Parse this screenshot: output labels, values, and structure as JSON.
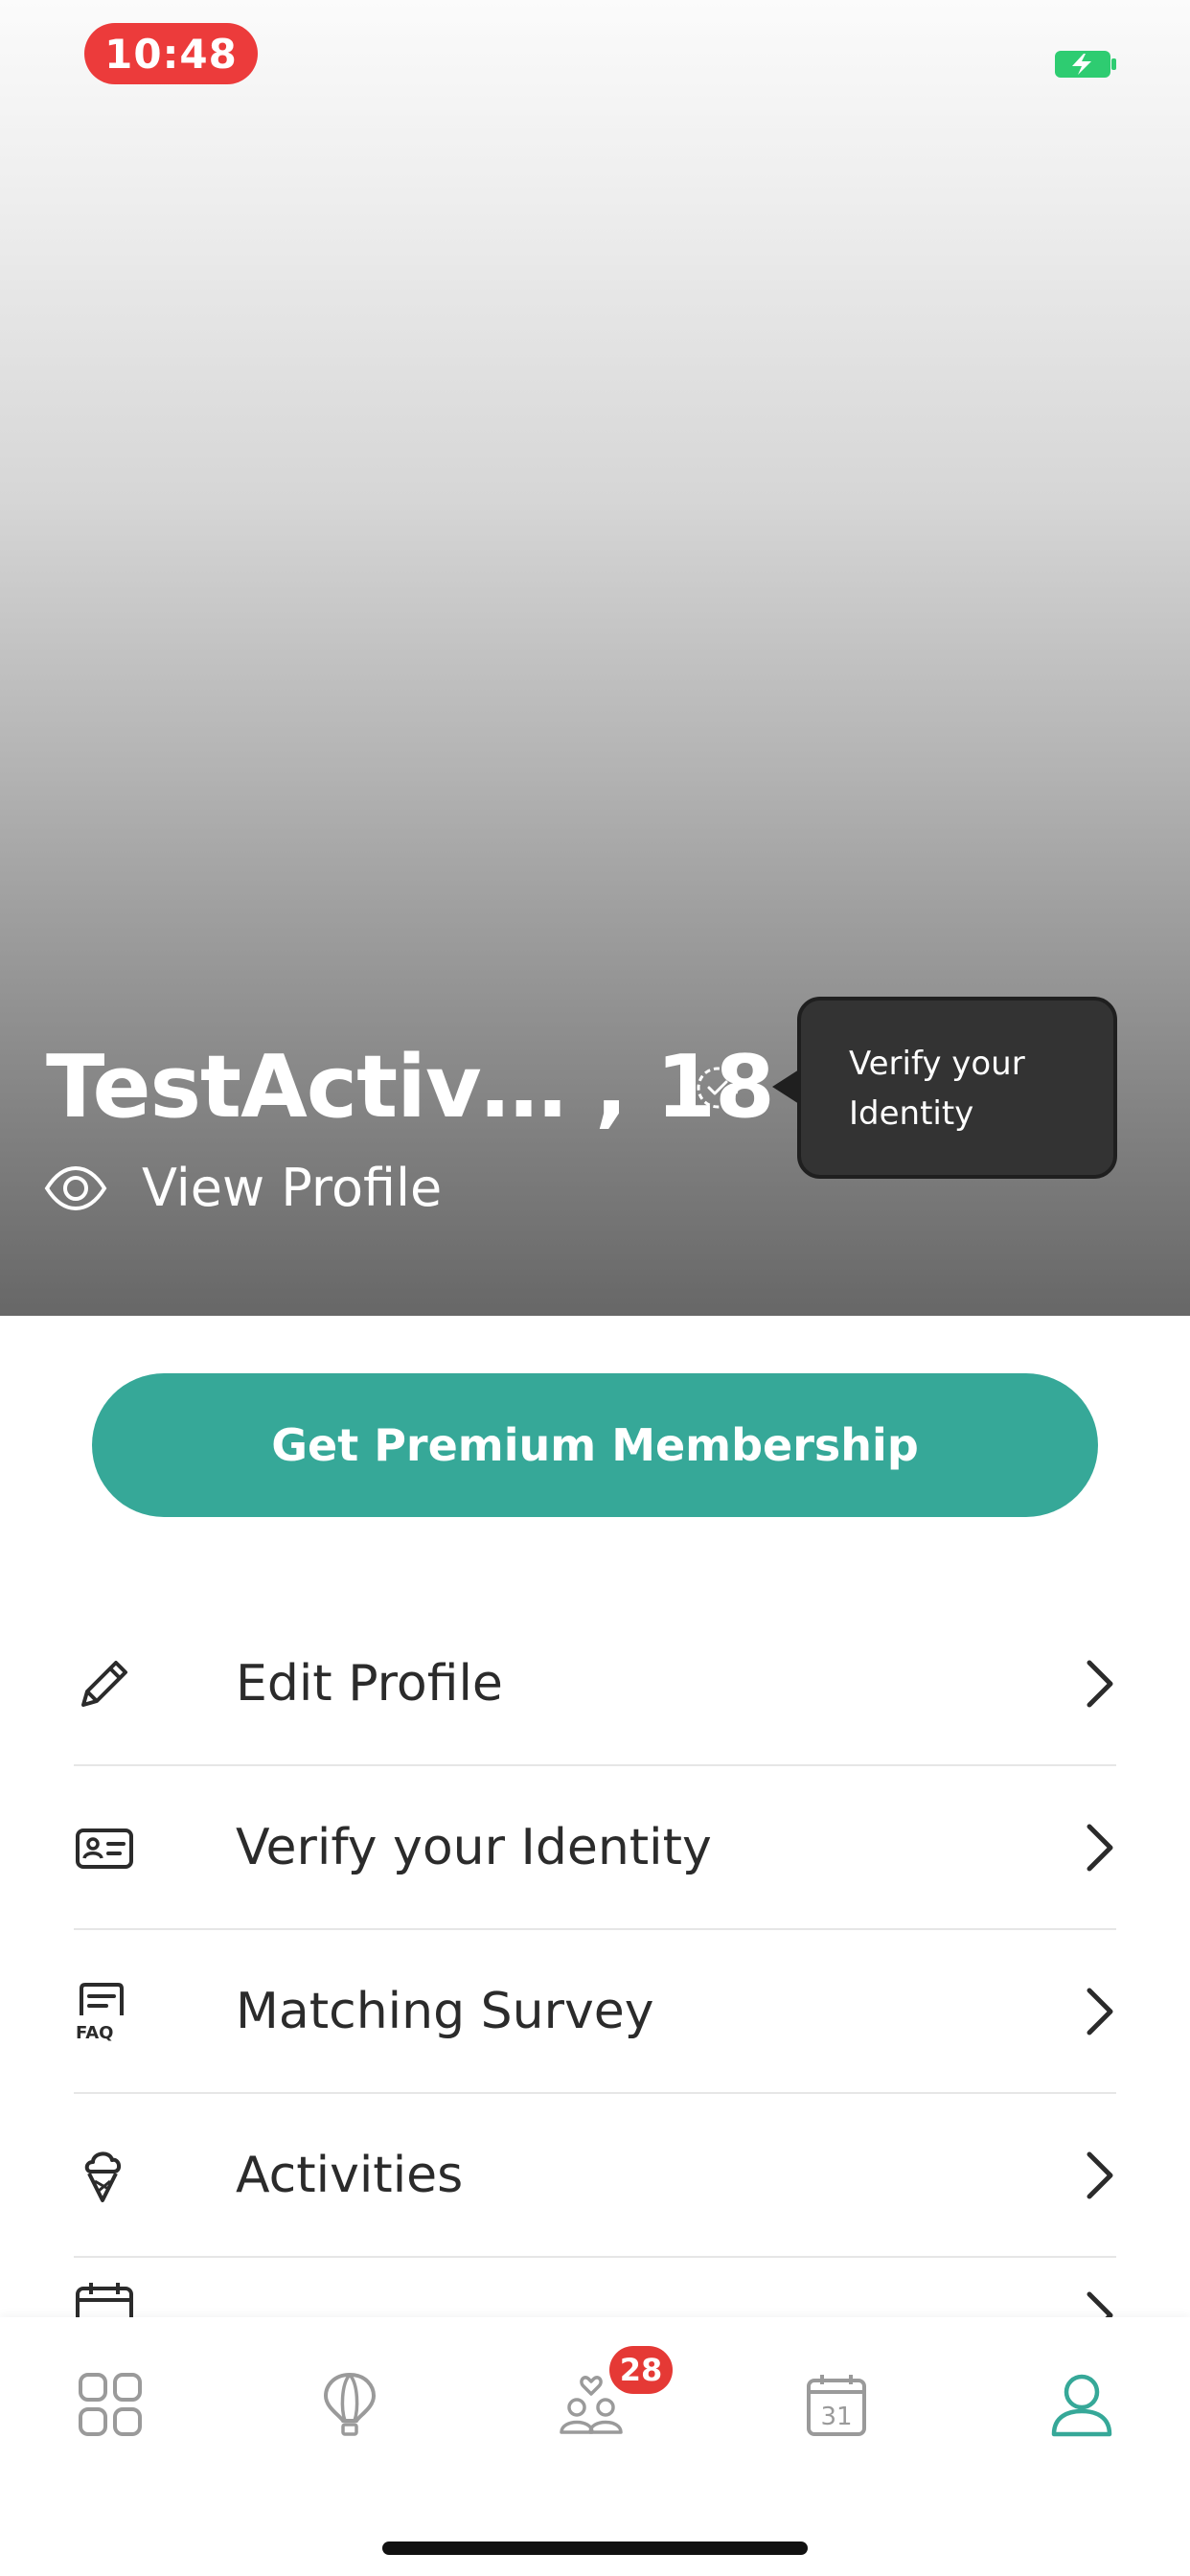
{
  "status_bar": {
    "time": "10:48",
    "time_pill_color": "#ec3b3b",
    "battery_color": "#2ecc71",
    "battery_state": "charging"
  },
  "profile": {
    "name_age": "TestActiv… , 18",
    "view_profile_label": "View Profile",
    "verify_tooltip": "Verify your Identity",
    "verify_icon": "dashed-check-circle-icon"
  },
  "premium": {
    "label": "Get Premium Membership",
    "color": "#36a898"
  },
  "menu": {
    "items": [
      {
        "label": "Edit Profile",
        "icon": "pencil-icon"
      },
      {
        "label": "Verify your Identity",
        "icon": "id-card-icon"
      },
      {
        "label": "Matching Survey",
        "icon": "faq-icon"
      },
      {
        "label": "Activities",
        "icon": "ice-cream-icon"
      },
      {
        "label": "",
        "icon": "calendar-icon"
      }
    ]
  },
  "tabbar": {
    "tabs": [
      {
        "name": "home",
        "icon": "grid-icon",
        "active": false
      },
      {
        "name": "explore",
        "icon": "hot-air-balloon-icon",
        "active": false
      },
      {
        "name": "matches",
        "icon": "people-heart-icon",
        "active": false,
        "badge": "28"
      },
      {
        "name": "calendar",
        "icon": "calendar-31-icon",
        "active": false,
        "day": "31"
      },
      {
        "name": "profile",
        "icon": "person-icon",
        "active": true
      }
    ],
    "active_color": "#36a898",
    "inactive_color": "#9a9a9a"
  }
}
